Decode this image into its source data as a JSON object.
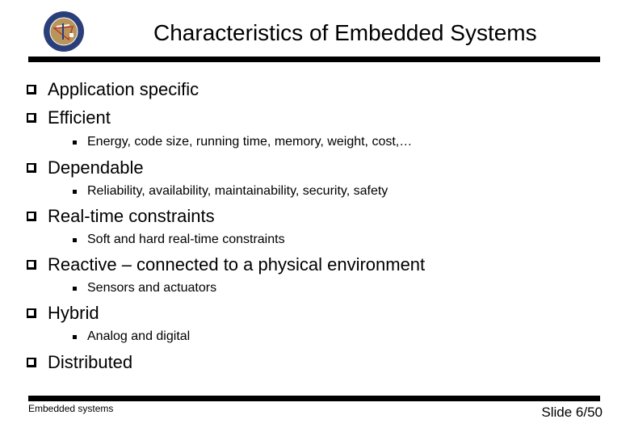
{
  "slide": {
    "title": "Characteristics of Embedded Systems",
    "logo_icon": "university-seal-logo",
    "bullets": [
      {
        "text": "Application specific",
        "sub": []
      },
      {
        "text": "Efficient",
        "sub": [
          "Energy, code size, running time, memory, weight, cost,…"
        ]
      },
      {
        "text": "Dependable",
        "sub": [
          "Reliability, availability, maintainability, security, safety"
        ]
      },
      {
        "text": "Real-time constraints",
        "sub": [
          "Soft and hard real-time constraints"
        ]
      },
      {
        "text": "Reactive – connected to a physical environment",
        "sub": [
          "Sensors and actuators"
        ]
      },
      {
        "text": "Hybrid",
        "sub": [
          "Analog and digital"
        ]
      },
      {
        "text": "Distributed",
        "sub": []
      }
    ],
    "footer": {
      "left": "Embedded systems",
      "right": "Slide 6/50"
    }
  }
}
